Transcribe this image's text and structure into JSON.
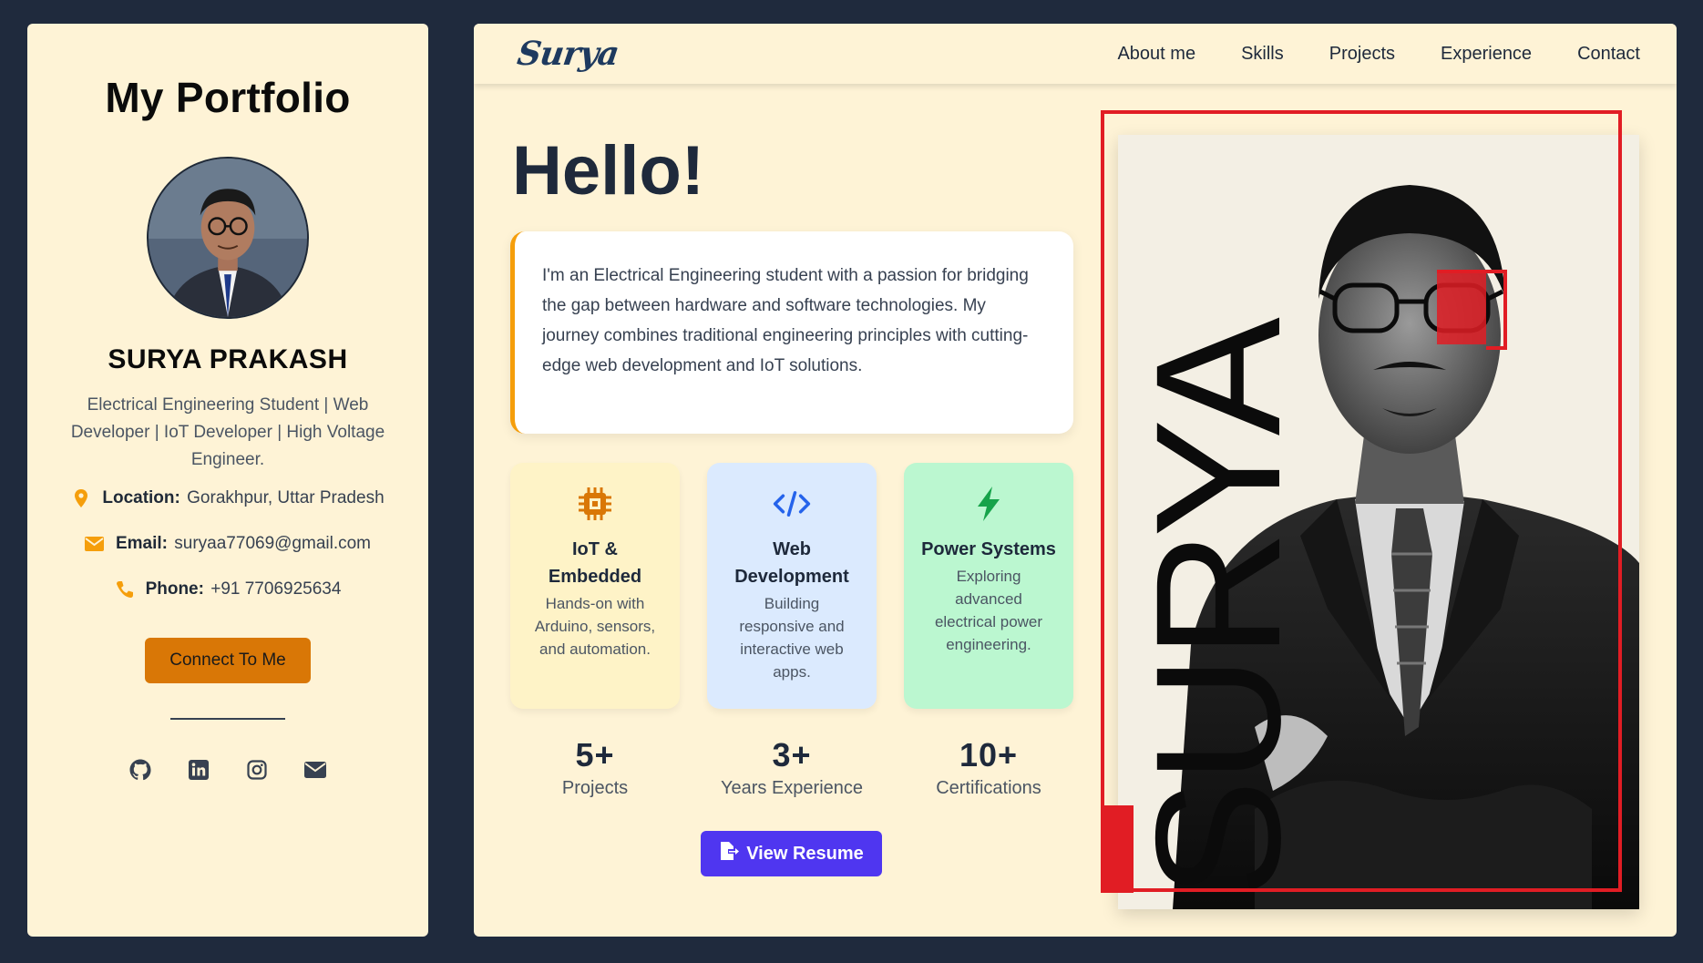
{
  "sidebar": {
    "title": "My Portfolio",
    "name": "SURYA PRAKASH",
    "tagline": "Electrical Engineering Student | Web Developer | IoT Developer | High Voltage Engineer.",
    "location_label": "Location:",
    "location_value": "Gorakhpur, Uttar Pradesh",
    "email_label": "Email:",
    "email_value": "suryaa77069@gmail.com",
    "phone_label": "Phone:",
    "phone_value": "+91 7706925634",
    "connect_label": "Connect To Me",
    "socials": [
      "github-icon",
      "linkedin-icon",
      "instagram-icon",
      "envelope-icon"
    ]
  },
  "nav": {
    "logo": "Surya",
    "links": [
      "About me",
      "Skills",
      "Projects",
      "Experience",
      "Contact"
    ]
  },
  "hero": {
    "greeting": "Hello!",
    "intro": "I'm an Electrical Engineering student with a passion for bridging the gap between hardware and software technologies. My journey combines traditional engineering principles with cutting-edge web development and IoT solutions.",
    "photo_word": "SURYA"
  },
  "features": [
    {
      "icon": "chip-icon",
      "title": "IoT & Embedded",
      "desc": "Hands-on with Arduino, sensors, and automation.",
      "bg": "#fef3c7",
      "color": "#d97706"
    },
    {
      "icon": "code-icon",
      "title": "Web Development",
      "desc": "Building responsive and interactive web apps.",
      "bg": "#dbeafe",
      "color": "#2563eb"
    },
    {
      "icon": "bolt-icon",
      "title": "Power Systems",
      "desc": "Exploring advanced electrical power engineering.",
      "bg": "#bbf7d0",
      "color": "#16a34a"
    }
  ],
  "stats": [
    {
      "num": "5+",
      "label": "Projects"
    },
    {
      "num": "3+",
      "label": "Years Experience"
    },
    {
      "num": "10+",
      "label": "Certifications"
    }
  ],
  "resume_label": "View Resume",
  "colors": {
    "page_bg": "#1f2a3d",
    "panel_bg": "#fef3d6",
    "accent_orange": "#d97706",
    "accent_purple": "#4f36f0",
    "frame_red": "#e11d24"
  }
}
